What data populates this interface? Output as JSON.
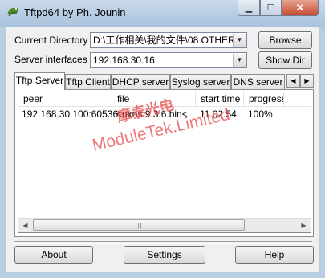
{
  "window": {
    "title": "Tftpd64 by Ph. Jounin",
    "minimize": "▁",
    "maximize": "☐",
    "close": "✕"
  },
  "config": {
    "current_directory_label": "Current Directory",
    "current_directory_value": "D:\\工作相关\\我的文件\\08 OTHER'",
    "browse_label": "Browse",
    "server_interfaces_label": "Server interfaces",
    "server_interfaces_value": "192.168.30.16",
    "show_dir_label": "Show Dir"
  },
  "tabs": [
    {
      "label": "Tftp Server",
      "active": true
    },
    {
      "label": "Tftp Client",
      "active": false
    },
    {
      "label": "DHCP server",
      "active": false
    },
    {
      "label": "Syslog server",
      "active": false
    },
    {
      "label": "DNS server",
      "active": false
    }
  ],
  "table": {
    "columns": [
      "peer",
      "file",
      "start time",
      "progress"
    ],
    "rows": [
      {
        "peer": "192.168.30.100:60536",
        "file": "<nxos.9.3.6.bin<",
        "start_time": "11.02.54",
        "progress": "100%"
      }
    ]
  },
  "watermark": {
    "chinese": "摩泰光电",
    "english": "ModuleTek.Limited"
  },
  "footer": {
    "about_label": "About",
    "settings_label": "Settings",
    "help_label": "Help"
  }
}
